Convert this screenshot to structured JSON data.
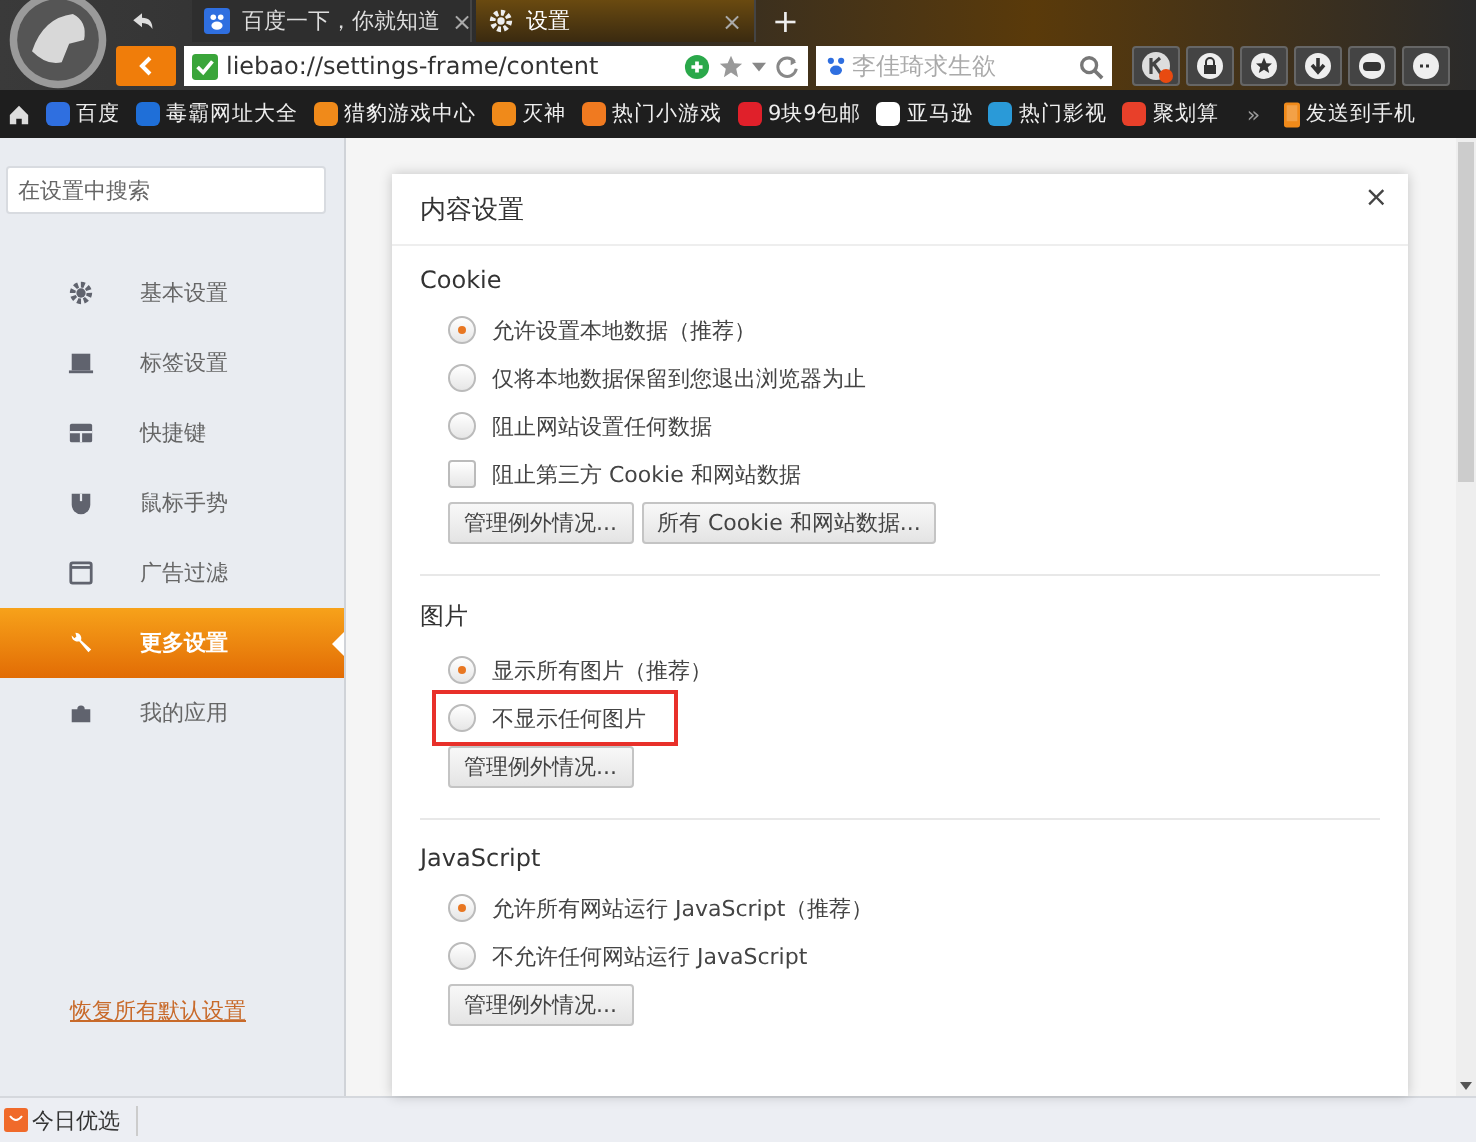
{
  "tabs": [
    {
      "label": "百度一下，你就知道",
      "close": "×",
      "selected": false
    },
    {
      "label": "设置",
      "close": "×",
      "selected": true
    }
  ],
  "new_tab": "+",
  "address_bar": {
    "url": "liebao://settings-frame/content"
  },
  "search": {
    "placeholder": "李佳琦求生欲"
  },
  "bookmarks": [
    {
      "label": "百度",
      "color": "#2f6fe0"
    },
    {
      "label": "毒霸网址大全",
      "color": "#1f6fd8"
    },
    {
      "label": "猎豹游戏中心",
      "color": "#f08a1a"
    },
    {
      "label": "灭神",
      "color": "#f08a1a"
    },
    {
      "label": "热门小游戏",
      "color": "#f07a20"
    },
    {
      "label": "9块9包邮",
      "color": "#e0202a"
    },
    {
      "label": "亚马逊",
      "color": "#ffffff"
    },
    {
      "label": "热门影视",
      "color": "#2a9ad8"
    },
    {
      "label": "聚划算",
      "color": "#e8402a"
    }
  ],
  "bookmarks_more": "»",
  "send_to_phone": "发送到手机",
  "sidebar": {
    "search": {
      "placeholder": "在设置中搜索"
    },
    "items": [
      {
        "label": "基本设置",
        "selected": false
      },
      {
        "label": "标签设置",
        "selected": false
      },
      {
        "label": "快捷键",
        "selected": false
      },
      {
        "label": "鼠标手势",
        "selected": false
      },
      {
        "label": "广告过滤",
        "selected": false
      },
      {
        "label": "更多设置",
        "selected": true
      },
      {
        "label": "我的应用",
        "selected": false
      }
    ],
    "reset_link": "恢复所有默认设置"
  },
  "dialog": {
    "title": "内容设置",
    "close": "×",
    "sections": [
      {
        "title": "Cookie",
        "options": [
          {
            "kind": "radio",
            "label": "允许设置本地数据（推荐）",
            "checked": true,
            "highlighted": false
          },
          {
            "kind": "radio",
            "label": "仅将本地数据保留到您退出浏览器为止",
            "checked": false,
            "highlighted": false
          },
          {
            "kind": "radio",
            "label": "阻止网站设置任何数据",
            "checked": false,
            "highlighted": false
          },
          {
            "kind": "checkbox",
            "label": "阻止第三方 Cookie 和网站数据",
            "checked": false,
            "highlighted": false
          }
        ],
        "buttons": [
          "管理例外情况...",
          "所有 Cookie 和网站数据..."
        ]
      },
      {
        "title": "图片",
        "options": [
          {
            "kind": "radio",
            "label": "显示所有图片（推荐）",
            "checked": true,
            "highlighted": false
          },
          {
            "kind": "radio",
            "label": "不显示任何图片",
            "checked": false,
            "highlighted": true
          }
        ],
        "buttons": [
          "管理例外情况..."
        ]
      },
      {
        "title": "JavaScript",
        "options": [
          {
            "kind": "radio",
            "label": "允许所有网站运行 JavaScript（推荐）",
            "checked": true,
            "highlighted": false
          },
          {
            "kind": "radio",
            "label": "不允许任何网站运行 JavaScript",
            "checked": false,
            "highlighted": false
          }
        ],
        "buttons": [
          "管理例外情况..."
        ]
      }
    ]
  },
  "status_bar": {
    "label": "今日优选"
  }
}
